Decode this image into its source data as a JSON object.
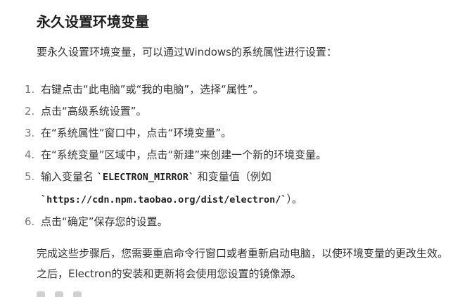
{
  "heading": "永久设置环境变量",
  "intro": "要永久设置环境变量，可以通过Windows的系统属性进行设置：",
  "steps": [
    {
      "num": "1.",
      "text": "右键点击“此电脑”或“我的电脑”，选择“属性”。"
    },
    {
      "num": "2.",
      "text": "点击“高级系统设置”。"
    },
    {
      "num": "3.",
      "text": "在“系统属性”窗口中，点击“环境变量”。"
    },
    {
      "num": "4.",
      "text": "在“系统变量”区域中，点击“新建”来创建一个新的环境变量。"
    },
    {
      "num": "5.",
      "text_before": "输入变量名 ",
      "code1": "`ELECTRON_MIRROR`",
      "text_mid": " 和变量值（例如",
      "code2": "`https://cdn.npm.taobao.org/dist/electron/`",
      "text_after": "）。"
    },
    {
      "num": "6.",
      "text": "点击“确定”保存您的设置。"
    }
  ],
  "summary": "完成这些步骤后，您需要重启命令行窗口或者重新启动电脑，以使环境变量的更改生效。之后，Electron的安装和更新将会使用您设置的镜像源。",
  "icons": [
    "copy-icon",
    "thumbs-up-icon",
    "thumbs-down-icon"
  ]
}
